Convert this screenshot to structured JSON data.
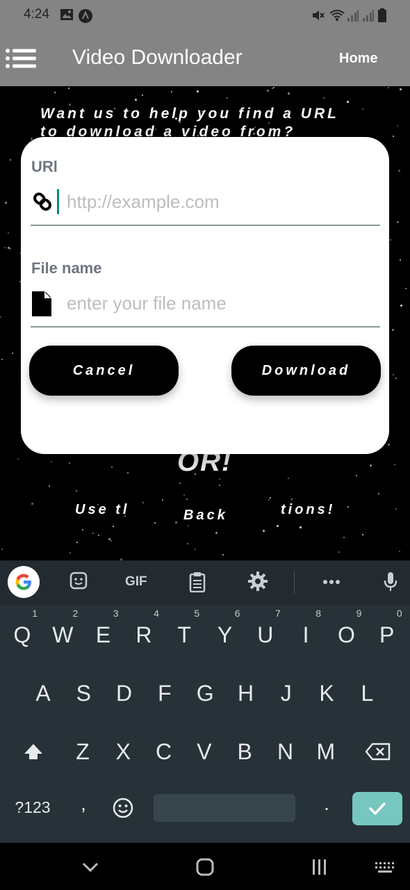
{
  "status_bar": {
    "time": "4:24",
    "icons": [
      "image-icon",
      "app-notification-icon",
      "mute-icon",
      "wifi-icon",
      "signal-icon",
      "signal-icon-2",
      "battery-icon"
    ]
  },
  "app_bar": {
    "title": "Video Downloader",
    "home_label": "Home",
    "menu_icon": "hamburger-menu-icon"
  },
  "background": {
    "promo_line1": "Want us to help you find a URL",
    "promo_line2": "to download a video from?",
    "or_text": "OR!",
    "use_text": "Use tl",
    "back_text": "Back",
    "tions_text": "tions!"
  },
  "dialog": {
    "url_label": "URl",
    "url_placeholder": "http://example.com",
    "url_value": "",
    "file_label": "File name",
    "file_placeholder": "enter your file name",
    "file_value": "",
    "cancel_label": "Cancel",
    "download_label": "Download"
  },
  "keyboard": {
    "toolbar": [
      "google-icon",
      "sticker-icon",
      "gif-label",
      "clipboard-icon",
      "settings-icon",
      "more-icon",
      "mic-icon"
    ],
    "gif_label": "GIF",
    "row1": [
      "Q",
      "W",
      "E",
      "R",
      "T",
      "Y",
      "U",
      "I",
      "O",
      "P"
    ],
    "row1_hints": [
      "1",
      "2",
      "3",
      "4",
      "5",
      "6",
      "7",
      "8",
      "9",
      "0"
    ],
    "row2": [
      "A",
      "S",
      "D",
      "F",
      "G",
      "H",
      "J",
      "K",
      "L"
    ],
    "row3": [
      "Z",
      "X",
      "C",
      "V",
      "B",
      "N",
      "M"
    ],
    "symbols_label": "?123",
    "comma": ",",
    "period": "."
  },
  "colors": {
    "app_bar": "#848484",
    "keyboard_bg": "#263238",
    "enter_key": "#76c7bf",
    "input_cursor": "#0a8a7a"
  }
}
